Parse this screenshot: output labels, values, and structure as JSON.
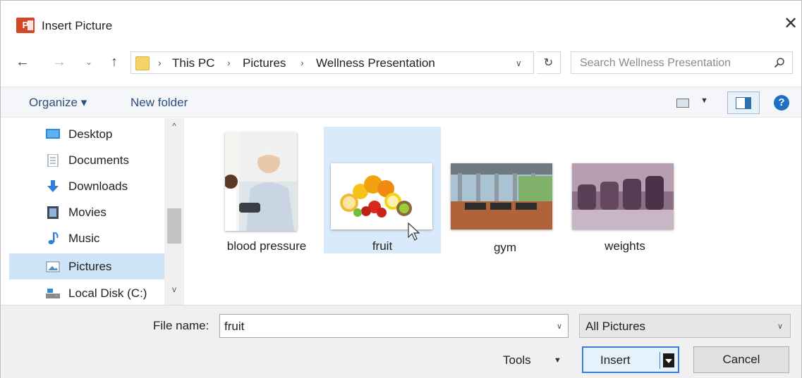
{
  "window": {
    "title": "Insert Picture",
    "app_icon": "powerpoint-icon",
    "close_glyph": "✕"
  },
  "address_bar": {
    "breadcrumbs": [
      "This PC",
      "Pictures",
      "Wellness Presentation"
    ],
    "separator": "›"
  },
  "search": {
    "placeholder": "Search Wellness Presentation"
  },
  "toolbar": {
    "organize_label": "Organize ▾",
    "new_folder_label": "New folder",
    "help_glyph": "?"
  },
  "sidebar": {
    "items": [
      {
        "label": "Desktop",
        "icon": "desktop-icon"
      },
      {
        "label": "Documents",
        "icon": "documents-icon"
      },
      {
        "label": "Downloads",
        "icon": "downloads-icon"
      },
      {
        "label": "Movies",
        "icon": "movies-icon"
      },
      {
        "label": "Music",
        "icon": "music-icon"
      },
      {
        "label": "Pictures",
        "icon": "pictures-icon",
        "selected": true
      },
      {
        "label": "Local Disk (C:)",
        "icon": "local-disk-icon"
      }
    ]
  },
  "files": [
    {
      "name": "blood pressure",
      "selected": false
    },
    {
      "name": "fruit",
      "selected": true
    },
    {
      "name": "gym",
      "selected": false
    },
    {
      "name": "weights",
      "selected": false
    }
  ],
  "footer": {
    "file_name_label": "File name:",
    "file_name_value": "fruit",
    "filter_value": "All Pictures",
    "tools_label": "Tools",
    "insert_label": "Insert",
    "cancel_label": "Cancel"
  },
  "colors": {
    "selection": "#cde3f7",
    "tile_selection": "#d9ebfa",
    "accent": "#3b7dd8",
    "link": "#2b4f7e",
    "app_brand": "#d24726"
  }
}
